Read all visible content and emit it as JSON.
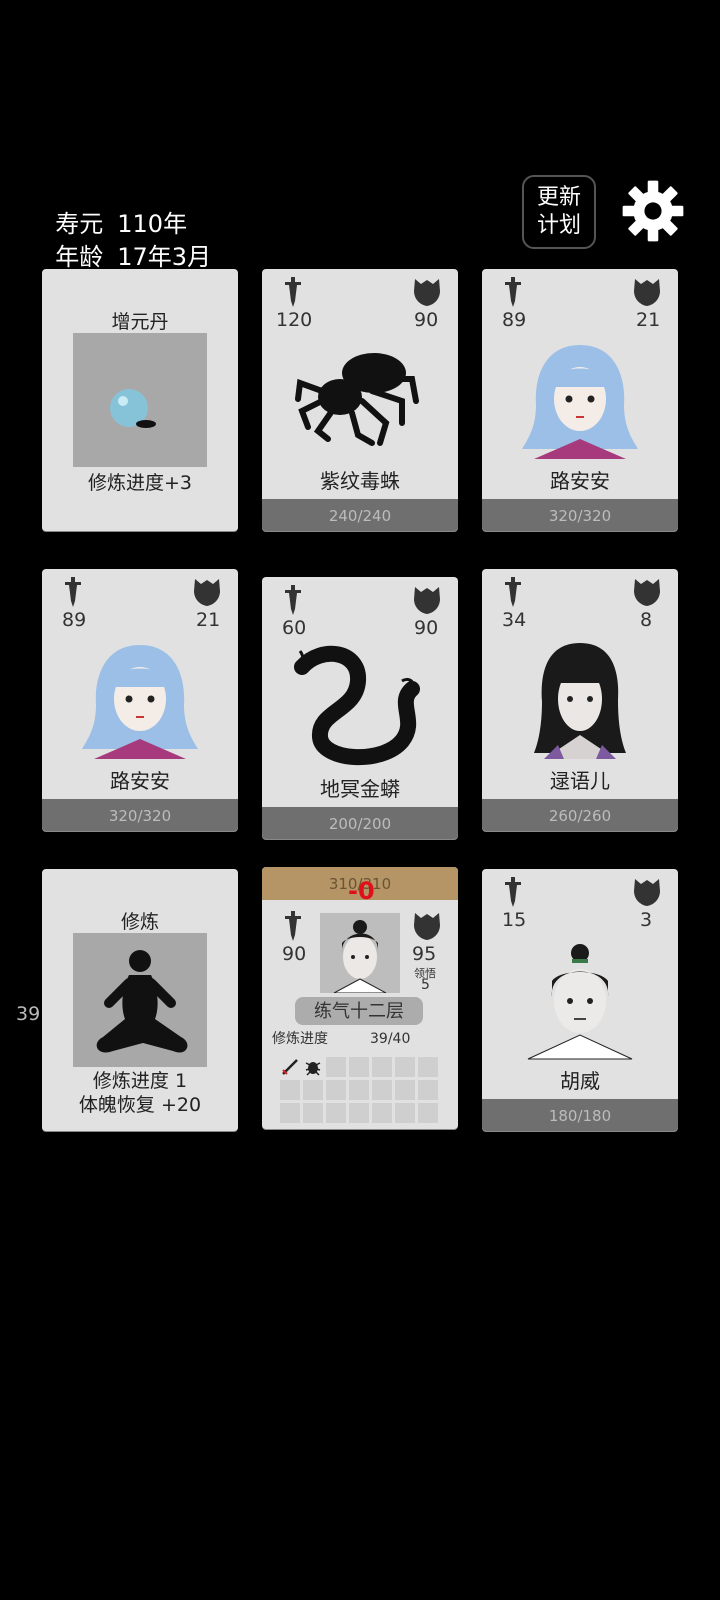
{
  "hud": {
    "lifespan_label": "寿元",
    "lifespan_value": "110年",
    "age_label": "年龄",
    "age_value": "17年3月",
    "update_button_line1": "更新",
    "update_button_line2": "计划",
    "settings_icon": "gear-icon"
  },
  "side_counter": "39",
  "cards": {
    "pill": {
      "title": "增元丹",
      "desc": "修炼进度+3"
    },
    "spider": {
      "atk": "120",
      "def": "90",
      "name": "紫纹毒蛛",
      "hp": "240/240"
    },
    "luanan1": {
      "atk": "89",
      "def": "21",
      "name": "路安安",
      "hp": "320/320"
    },
    "luanan2": {
      "atk": "89",
      "def": "21",
      "name": "路安安",
      "hp": "320/320"
    },
    "python": {
      "atk": "60",
      "def": "90",
      "name": "地冥金蟒",
      "hp": "200/200"
    },
    "yuer": {
      "atk": "34",
      "def": "8",
      "name": "逯语儿",
      "hp": "260/260"
    },
    "cultivate": {
      "title": "修炼",
      "line1": "修炼进度  1",
      "line2": "体魄恢复  +20"
    },
    "player": {
      "hp": "310/310",
      "damage_popup": "-0",
      "atk": "90",
      "def": "95",
      "comprehension_label": "领悟",
      "comprehension_value": "5",
      "realm": "练气十二层",
      "progress_label": "修炼进度",
      "progress_value": "39/40"
    },
    "huwei": {
      "atk": "15",
      "def": "3",
      "name": "胡威",
      "hp": "180/180"
    }
  },
  "colors": {
    "background": "#000000",
    "card": "#e1e1e1",
    "hp_bar": "#6f6f6f",
    "player_hp_bar": "#b59466",
    "damage": "#e0101a"
  }
}
